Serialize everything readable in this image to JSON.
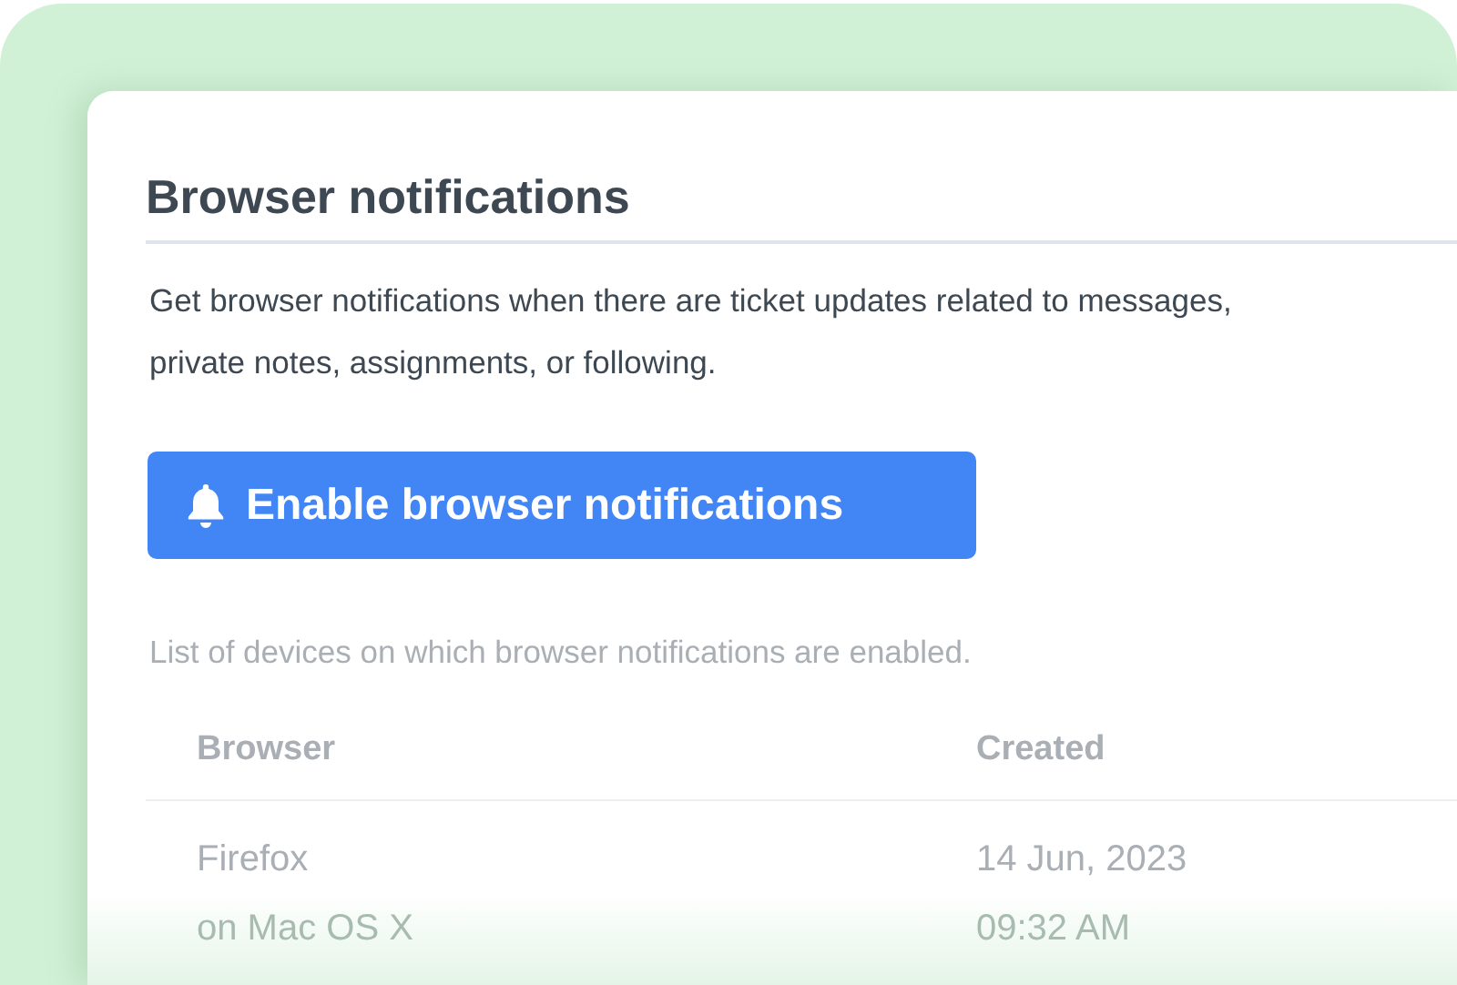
{
  "title": "Browser notifications",
  "description": "Get browser notifications when there are ticket updates related to messages, private notes, assignments, or following.",
  "enable_button": {
    "label": "Enable browser notifications"
  },
  "devices_caption": "List of devices on which browser notifications are enabled.",
  "table": {
    "columns": [
      "Browser",
      "Created"
    ],
    "rows": [
      {
        "browser": "Firefox",
        "platform": "on Mac OS X",
        "date": "14 Jun, 2023",
        "time": "09:32 AM"
      }
    ]
  }
}
